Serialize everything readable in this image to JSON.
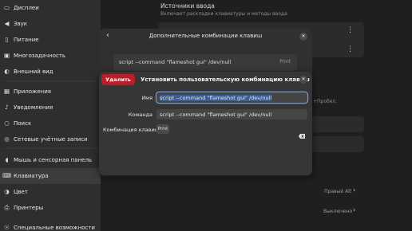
{
  "sidebar": {
    "items": [
      {
        "label": "Дисплеи",
        "icon": "display-icon",
        "glyph": "▭"
      },
      {
        "label": "Звук",
        "icon": "speaker-icon",
        "glyph": "◀"
      },
      {
        "label": "Питание",
        "icon": "battery-icon",
        "glyph": "▯"
      },
      {
        "label": "Многозадачность",
        "icon": "multitasking-icon",
        "glyph": "▣"
      },
      {
        "label": "Внешний вид",
        "icon": "appearance-icon",
        "glyph": "◐"
      },
      {
        "label": "Приложения",
        "icon": "apps-icon",
        "glyph": "▦"
      },
      {
        "label": "Уведомления",
        "icon": "bell-icon",
        "glyph": "♪"
      },
      {
        "label": "Поиск",
        "icon": "search-icon",
        "glyph": "○"
      },
      {
        "label": "Сетевые учётные записи",
        "icon": "online-accounts-icon",
        "glyph": "◎"
      },
      {
        "label": "Мышь и сенсорная панель",
        "icon": "mouse-icon",
        "glyph": "◖"
      },
      {
        "label": "Клавиатура",
        "icon": "keyboard-icon",
        "glyph": "⌨"
      },
      {
        "label": "Цвет",
        "icon": "color-icon",
        "glyph": "◑"
      },
      {
        "label": "Принтеры",
        "icon": "printer-icon",
        "glyph": "⎙"
      },
      {
        "label": "Специальные возможности",
        "icon": "accessibility-icon",
        "glyph": "☉"
      }
    ]
  },
  "main": {
    "section_title": "Источники ввода",
    "section_subtitle": "Включает раскладки клавиатуры и методы ввода",
    "right_fragment": "+Пробел.",
    "row1_value": "Правый Alt",
    "row2_value": "Выключено"
  },
  "back_dialog": {
    "title": "Дополнительные комбинации клавиш",
    "shortcut_command": "script --command \"flameshot gui\" /dev/null",
    "shortcut_key": "Print"
  },
  "dialog": {
    "delete_label": "Удалить",
    "title": "Установить пользовательскую комбинацию клавиш",
    "name_label": "Имя",
    "name_value": "script --command \"flameshot gui\" /dev/null",
    "command_label": "Команда",
    "command_value": "script --command \"flameshot gui\" /dev/null",
    "combo_label": "Комбинация клавиш",
    "combo_key": "Print"
  },
  "colors": {
    "accent": "#3a5f97",
    "destructive": "#c01c28"
  }
}
